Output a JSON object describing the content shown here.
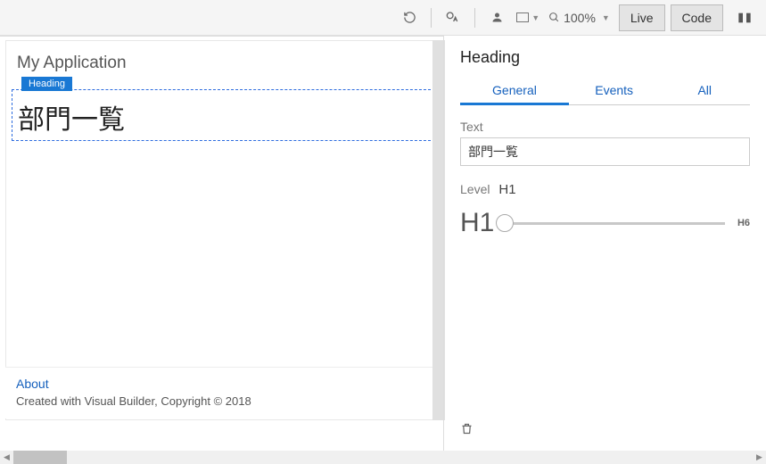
{
  "toolbar": {
    "reload_icon": "reload",
    "world_icon": "translate",
    "user_icon": "user",
    "viewport_icon": "viewport",
    "zoom_label": "100%",
    "live_label": "Live",
    "code_label": "Code"
  },
  "canvas": {
    "app_title": "My Application",
    "selected_tag": "Heading",
    "heading_text": "部門一覧",
    "footer_link": "About",
    "footer_copy": "Created with Visual Builder, Copyright © 2018"
  },
  "props": {
    "title": "Heading",
    "tabs": {
      "general": "General",
      "events": "Events",
      "all": "All"
    },
    "text_label": "Text",
    "text_value": "部門一覧",
    "level_label": "Level",
    "level_value": "H1",
    "slider_min": "H1",
    "slider_max": "H6"
  }
}
